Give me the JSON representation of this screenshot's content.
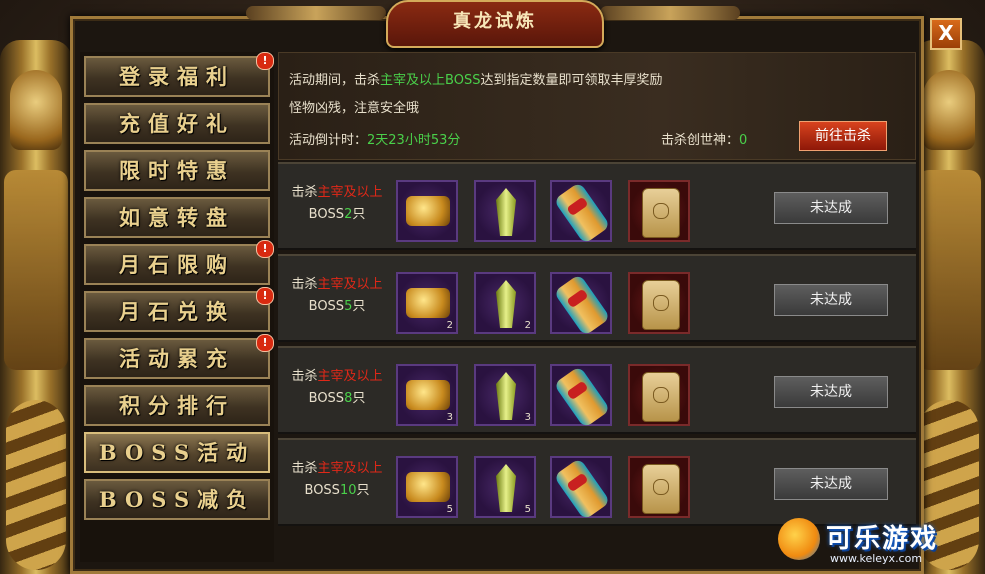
{
  "window": {
    "title": "真龙试炼",
    "close_label": "X"
  },
  "sidebar": {
    "items": [
      {
        "label": "登录福利",
        "badge": "!",
        "selected": false
      },
      {
        "label": "充值好礼",
        "badge": "",
        "selected": false
      },
      {
        "label": "限时特惠",
        "badge": "",
        "selected": false
      },
      {
        "label": "如意转盘",
        "badge": "",
        "selected": false
      },
      {
        "label": "月石限购",
        "badge": "!",
        "selected": false
      },
      {
        "label": "月石兑换",
        "badge": "!",
        "selected": false
      },
      {
        "label": "活动累充",
        "badge": "!",
        "selected": false
      },
      {
        "label": "积分排行",
        "badge": "",
        "selected": false
      },
      {
        "label": "BOSS活动",
        "badge": "",
        "selected": true
      },
      {
        "label": "BOSS减负",
        "badge": "",
        "selected": false
      }
    ]
  },
  "info": {
    "line1_prefix": "活动期间，击杀",
    "line1_highlight": "主宰及以上BOSS",
    "line1_suffix": "达到指定数量即可领取丰厚奖励",
    "line2": "怪物凶残，注意安全哦",
    "countdown_label": "活动倒计时：",
    "countdown_value": "2天23小时53分",
    "kill_label": "击杀创世神：",
    "kill_value": "0",
    "goto_button": "前往击杀"
  },
  "rows": [
    {
      "kill_prefix": "击杀",
      "kill_rank": "主宰及以上",
      "boss_label": "BOSS",
      "count": "2",
      "unit": "只",
      "rewards": [
        {
          "icon": "gold-chest-icon",
          "qty": ""
        },
        {
          "icon": "crystal-icon",
          "qty": ""
        },
        {
          "icon": "scroll-icon",
          "qty": ""
        },
        {
          "icon": "token-icon",
          "qty": ""
        }
      ],
      "status": "未达成"
    },
    {
      "kill_prefix": "击杀",
      "kill_rank": "主宰及以上",
      "boss_label": "BOSS",
      "count": "5",
      "unit": "只",
      "rewards": [
        {
          "icon": "gold-chest-icon",
          "qty": "2"
        },
        {
          "icon": "crystal-icon",
          "qty": "2"
        },
        {
          "icon": "scroll-icon",
          "qty": ""
        },
        {
          "icon": "token-icon",
          "qty": ""
        }
      ],
      "status": "未达成"
    },
    {
      "kill_prefix": "击杀",
      "kill_rank": "主宰及以上",
      "boss_label": "BOSS",
      "count": "8",
      "unit": "只",
      "rewards": [
        {
          "icon": "gold-chest-icon",
          "qty": "3"
        },
        {
          "icon": "crystal-icon",
          "qty": "3"
        },
        {
          "icon": "scroll-icon",
          "qty": ""
        },
        {
          "icon": "token-icon",
          "qty": ""
        }
      ],
      "status": "未达成"
    },
    {
      "kill_prefix": "击杀",
      "kill_rank": "主宰及以上",
      "boss_label": "BOSS",
      "count": "10",
      "unit": "只",
      "rewards": [
        {
          "icon": "gold-chest-icon",
          "qty": "5"
        },
        {
          "icon": "crystal-icon",
          "qty": "5"
        },
        {
          "icon": "scroll-icon",
          "qty": ""
        },
        {
          "icon": "token-icon",
          "qty": ""
        }
      ],
      "status": "未达成"
    }
  ],
  "watermark": {
    "text": "可乐游戏",
    "url": "www.keleyx.com"
  }
}
